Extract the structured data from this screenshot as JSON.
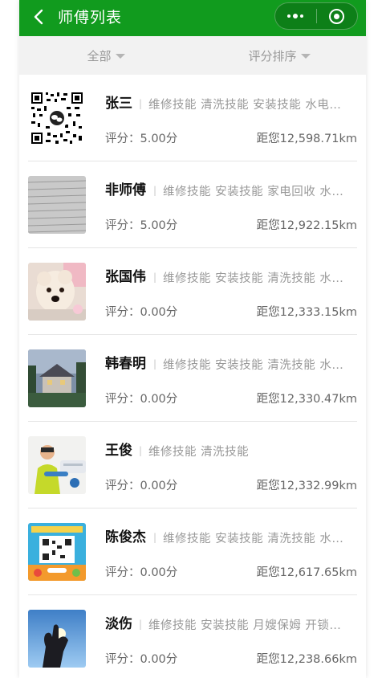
{
  "header": {
    "title": "师傅列表"
  },
  "filter": {
    "all_label": "全部",
    "sort_label": "评分排序"
  },
  "masters": [
    {
      "name": "张三",
      "skills": "维修技能 清洗技能 安装技能 水电…",
      "score_label": "评分：5.00分",
      "distance": "距您12,598.71km",
      "avatar": "qr-code"
    },
    {
      "name": "非师傅",
      "skills": "维修技能 安装技能 家电回收 水…",
      "score_label": "评分：5.00分",
      "distance": "距您12,922.15km",
      "avatar": "gray-lines"
    },
    {
      "name": "张国伟",
      "skills": "维修技能 安装技能 清洗技能 水…",
      "score_label": "评分：0.00分",
      "distance": "距您12,333.15km",
      "avatar": "puppy-photo"
    },
    {
      "name": "韩春明",
      "skills": "维修技能 安装技能 清洗技能 水…",
      "score_label": "评分：0.00分",
      "distance": "距您12,330.47km",
      "avatar": "house-photo"
    },
    {
      "name": "王俊",
      "skills": "维修技能 清洗技能",
      "score_label": "评分：0.00分",
      "distance": "距您12,332.99km",
      "avatar": "technician-photo"
    },
    {
      "name": "陈俊杰",
      "skills": "维修技能 安装技能 清洗技能 水…",
      "score_label": "评分：0.00分",
      "distance": "距您12,617.65km",
      "avatar": "app-promo-qr"
    },
    {
      "name": "淡伤",
      "skills": "维修技能 安装技能 月嫂保姆 开锁…",
      "score_label": "评分：0.00分",
      "distance": "距您12,238.66km",
      "avatar": "hand-sky-photo"
    }
  ],
  "colors": {
    "nav": "#119b1e",
    "filter_bg": "#f2f2f2"
  }
}
